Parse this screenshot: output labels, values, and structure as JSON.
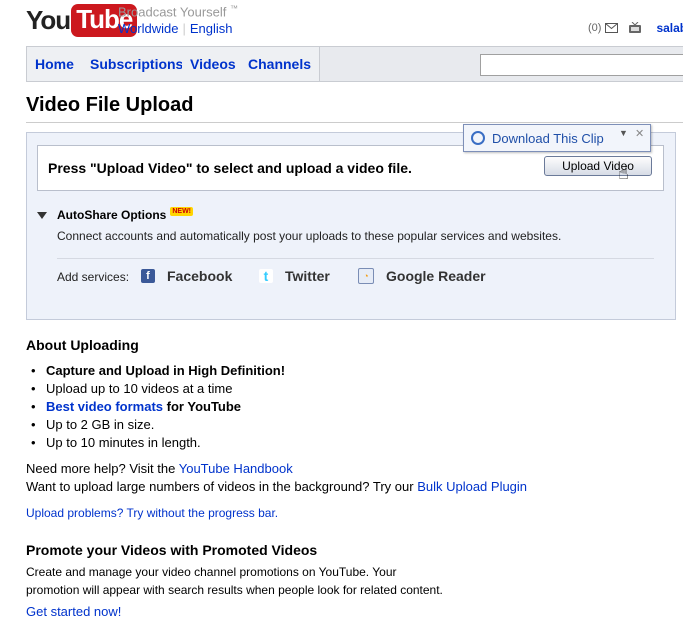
{
  "header": {
    "logo_you": "You",
    "logo_tube": "Tube",
    "tagline": "Broadcast Yourself",
    "tagline_tm": "™",
    "locale_region": "Worldwide",
    "locale_lang": "English",
    "inbox_count": "(0)",
    "username": "salabl"
  },
  "nav": {
    "tabs": [
      "Home",
      "Subscriptions",
      "Videos",
      "Channels"
    ],
    "search_value": ""
  },
  "page_title": "Video File Upload",
  "upload": {
    "instruction": "Press \"Upload Video\" to select and upload a video file.",
    "button_label": "Upload Video"
  },
  "download_clip": {
    "label": "Download This Clip"
  },
  "autoshare": {
    "label": "AutoShare Options",
    "badge": "NEW!",
    "description": "Connect accounts and automatically post your uploads to these popular services and websites.",
    "add_label": "Add services:",
    "services": [
      "Facebook",
      "Twitter",
      "Google Reader"
    ]
  },
  "about": {
    "heading": "About Uploading",
    "items": {
      "hd": "Capture and Upload in High Definition!",
      "count": "Upload up to 10 videos at a time",
      "formats_link": "Best video formats",
      "formats_rest": " for YouTube",
      "size": "Up to 2 GB in size.",
      "length": "Up to 10 minutes in length."
    },
    "help_text": "Need more help? Visit the ",
    "help_link": "YouTube Handbook",
    "bulk_text": "Want to upload large numbers of videos in the background? Try our ",
    "bulk_link": "Bulk Upload Plugin",
    "problems_link": "Upload problems? Try without the progress bar."
  },
  "promote": {
    "heading": "Promote your Videos with Promoted Videos",
    "line1": "Create and manage your video channel promotions on YouTube. Your",
    "line2": "promotion will appear with search results when people look for related content.",
    "cta": "Get started now!"
  },
  "colors": {
    "link": "#0033cc",
    "logo_red": "#cc181e",
    "panel_bg": "#eef2fa"
  }
}
